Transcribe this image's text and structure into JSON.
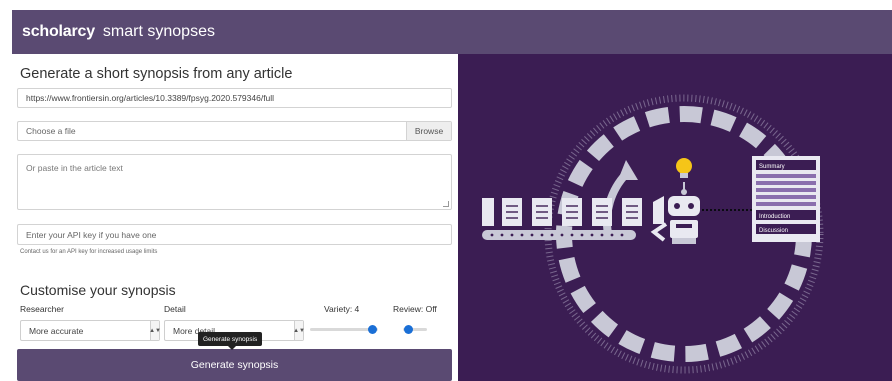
{
  "header": {
    "brand": "scholarcy",
    "subtitle": "smart synopses"
  },
  "form": {
    "title": "Generate a short synopsis from any article",
    "url_value": "https://www.frontiersin.org/articles/10.3389/fpsyg.2020.579346/full",
    "file_placeholder": "Choose a file",
    "browse_label": "Browse",
    "text_placeholder": "Or paste in the article text",
    "api_placeholder": "Enter your API key if you have one",
    "api_hint": "Contact us for an API key for increased usage limits"
  },
  "customise": {
    "title": "Customise your synopsis",
    "researcher_label": "Researcher",
    "researcher_value": "More accurate",
    "detail_label": "Detail",
    "detail_value": "More detail",
    "variety_label": "Variety: 4",
    "variety_value": 4,
    "review_label": "Review: Off",
    "review_value": "Off",
    "tooltip": "Generate synopsis",
    "generate_label": "Generate synopsis"
  },
  "illustration": {
    "summary_label": "Summary",
    "introduction_label": "Introduction",
    "discussion_label": "Discussion",
    "colors": {
      "background": "#3b1d53",
      "light": "#c8c8d6",
      "bulb": "#f5c518"
    }
  }
}
